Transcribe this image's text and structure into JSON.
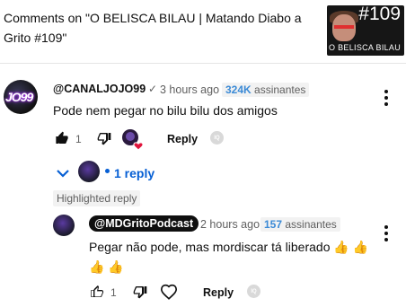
{
  "header": {
    "title": "Comments on \"O BELISCA BILAU | Matando Diabo a Grito #109\"",
    "thumb_number": "#109",
    "thumb_caption": "O BELISCA BILAU"
  },
  "comment": {
    "avatar_text": "JO99",
    "author": "@CANALJOJO99",
    "verified": "✓",
    "time": "3 hours ago",
    "subscribers_count": "324K",
    "subscribers_label": "assinantes",
    "text": "Pode nem pegar no bilu bilu dos amigos",
    "like_count": "1",
    "reply_label": "Reply",
    "iq_label": "IQ"
  },
  "replies_toggle": {
    "label": "1 reply"
  },
  "highlighted_label": "Highlighted reply",
  "reply": {
    "author": "@MDGritoPodcast",
    "time": "2 hours ago",
    "subscribers_count": "157",
    "subscribers_label": "assinantes",
    "text": "Pegar não pode, mas mordiscar tá liberado 👍 👍 👍 👍",
    "like_count": "1",
    "reply_label": "Reply",
    "iq_label": "IQ"
  },
  "colors": {
    "link_blue": "#065fd4",
    "badge_blue": "#3b8ad6",
    "heart_red": "#e0143c",
    "muted": "#606060"
  }
}
